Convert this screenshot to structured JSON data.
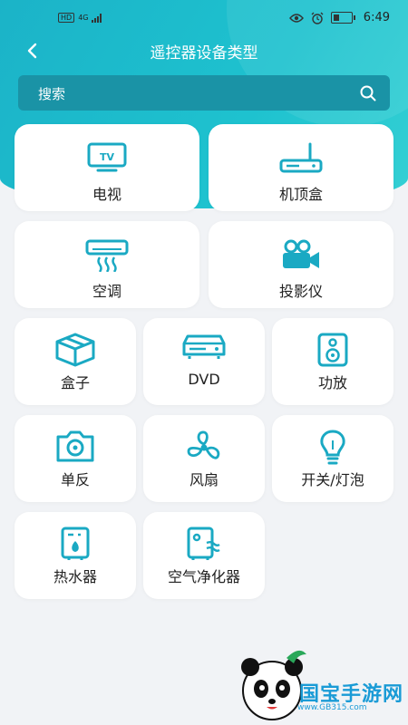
{
  "status": {
    "network": "4G",
    "hd": "HD",
    "time": "6:49"
  },
  "header": {
    "title": "遥控器设备类型"
  },
  "search": {
    "placeholder": "搜索"
  },
  "devices": [
    {
      "label": "电视",
      "icon": "tv-icon"
    },
    {
      "label": "机顶盒",
      "icon": "router-icon"
    },
    {
      "label": "空调",
      "icon": "air-conditioner-icon"
    },
    {
      "label": "投影仪",
      "icon": "projector-icon"
    },
    {
      "label": "盒子",
      "icon": "box-icon"
    },
    {
      "label": "DVD",
      "icon": "dvd-player-icon"
    },
    {
      "label": "功放",
      "icon": "speaker-icon"
    },
    {
      "label": "单反",
      "icon": "camera-icon"
    },
    {
      "label": "风扇",
      "icon": "fan-icon"
    },
    {
      "label": "开关/灯泡",
      "icon": "light-bulb-icon"
    },
    {
      "label": "热水器",
      "icon": "water-heater-icon"
    },
    {
      "label": "空气净化器",
      "icon": "air-purifier-icon"
    }
  ],
  "watermark": {
    "text": "国宝手游网",
    "url": "www.GB315.com"
  },
  "colors": {
    "accent": "#1ec2cf",
    "icon": "#1aa9c3",
    "search_bg": "#1a93a6",
    "background": "#f1f3f6"
  }
}
